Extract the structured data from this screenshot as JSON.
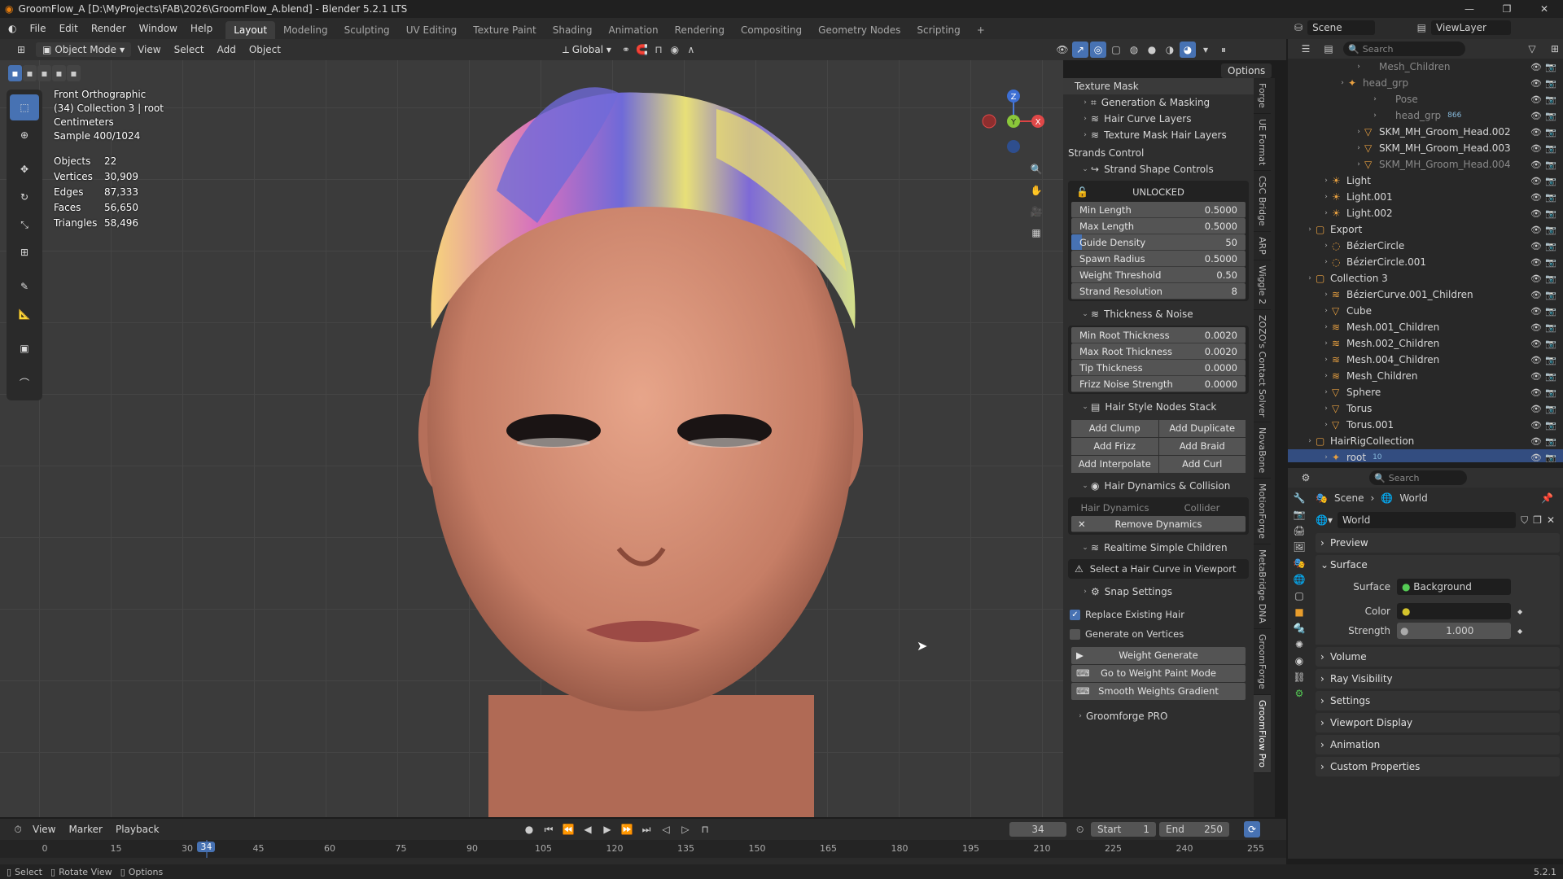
{
  "title": "GroomFlow_A [D:\\MyProjects\\FAB\\2026\\GroomFlow_A.blend] - Blender 5.2.1 LTS",
  "menus": [
    "File",
    "Edit",
    "Render",
    "Window",
    "Help"
  ],
  "workspaces": [
    "Layout",
    "Modeling",
    "Sculpting",
    "UV Editing",
    "Texture Paint",
    "Shading",
    "Animation",
    "Rendering",
    "Compositing",
    "Geometry Nodes",
    "Scripting"
  ],
  "viewport_header": {
    "mode": "Object Mode",
    "menus": [
      "View",
      "Select",
      "Add",
      "Object"
    ],
    "transform": "Global",
    "options": "Options"
  },
  "viewport_info": {
    "view": "Front Orthographic",
    "collection": "(34) Collection 3 | root",
    "units": "Centimeters",
    "sample": "Sample 400/1024"
  },
  "stats": [
    {
      "label": "Objects",
      "value": "22"
    },
    {
      "label": "Vertices",
      "value": "30,909"
    },
    {
      "label": "Edges",
      "value": "87,333"
    },
    {
      "label": "Faces",
      "value": "56,650"
    },
    {
      "label": "Triangles",
      "value": "58,496"
    }
  ],
  "gizmo": {
    "z": "Z",
    "y": "Y",
    "x": "X"
  },
  "npanel": {
    "texture_mask": "Texture Mask",
    "gen_masking": "Generation & Masking",
    "hair_curve_layers": "Hair Curve Layers",
    "texture_mask_layers": "Texture Mask Hair Layers",
    "strands_control": "Strands Control",
    "strand_shape": "Strand Shape Controls",
    "unlocked": "UNLOCKED",
    "shape_fields": [
      {
        "label": "Min Length",
        "value": "0.5000"
      },
      {
        "label": "Max Length",
        "value": "0.5000"
      },
      {
        "label": "Guide Density",
        "value": "50"
      },
      {
        "label": "Spawn Radius",
        "value": "0.5000"
      },
      {
        "label": "Weight Threshold",
        "value": "0.50"
      },
      {
        "label": "Strand Resolution",
        "value": "8"
      }
    ],
    "thickness_noise": "Thickness & Noise",
    "thickness_fields": [
      {
        "label": "Min Root Thickness",
        "value": "0.0020"
      },
      {
        "label": "Max Root Thickness",
        "value": "0.0020"
      },
      {
        "label": "Tip Thickness",
        "value": "0.0000"
      },
      {
        "label": "Frizz Noise Strength",
        "value": "0.0000"
      }
    ],
    "hair_style_stack": "Hair Style Nodes Stack",
    "style_buttons": [
      "Add Clump",
      "Add Duplicate",
      "Add Frizz",
      "Add Braid",
      "Add Interpolate",
      "Add Curl"
    ],
    "dynamics": "Hair Dynamics & Collision",
    "hair_dynamics": "Hair Dynamics",
    "collider": "Collider",
    "remove_dynamics": "Remove Dynamics",
    "realtime_children": "Realtime Simple Children",
    "select_curve": "Select a Hair Curve in Viewport",
    "snap_settings": "Snap Settings",
    "replace_hair": "Replace Existing Hair",
    "gen_vertices": "Generate on Vertices",
    "weight_generate": "Weight Generate",
    "goto_weight": "Go to Weight Paint Mode",
    "smooth_weights": "Smooth Weights Gradient",
    "groomforge": "Groomforge PRO"
  },
  "side_tabs": [
    "Forge",
    "UE Format",
    "CSC Bridge",
    "ARP",
    "Wiggle 2",
    "ZOZO's Contact Solver",
    "NovaBone",
    "MotionForge",
    "MetaBridge DNA",
    "GroomForge",
    "GroomFlow Pro"
  ],
  "outliner": {
    "scene": "Scene",
    "viewlayer": "ViewLayer",
    "search_placeholder": "Search",
    "rows": [
      {
        "label": "Mesh_Children",
        "indent": 4,
        "dim": true,
        "icon": ""
      },
      {
        "label": "head_grp",
        "indent": 3,
        "dim": true,
        "icon": "✦"
      },
      {
        "label": "Pose",
        "indent": 5,
        "dim": true,
        "icon": ""
      },
      {
        "label": "head_grp",
        "indent": 5,
        "dim": true,
        "icon": "",
        "badge": "866"
      },
      {
        "label": "SKM_MH_Groom_Head.002",
        "indent": 4,
        "dim": false,
        "icon": "▽"
      },
      {
        "label": "SKM_MH_Groom_Head.003",
        "indent": 4,
        "dim": false,
        "icon": "▽"
      },
      {
        "label": "SKM_MH_Groom_Head.004",
        "indent": 4,
        "dim": true,
        "icon": "▽"
      },
      {
        "label": "Light",
        "indent": 2,
        "dim": false,
        "icon": "☀"
      },
      {
        "label": "Light.001",
        "indent": 2,
        "dim": false,
        "icon": "☀"
      },
      {
        "label": "Light.002",
        "indent": 2,
        "dim": false,
        "icon": "☀"
      },
      {
        "label": "Export",
        "indent": 1,
        "dim": false,
        "icon": "▢"
      },
      {
        "label": "BézierCircle",
        "indent": 2,
        "dim": false,
        "icon": "◌"
      },
      {
        "label": "BézierCircle.001",
        "indent": 2,
        "dim": false,
        "icon": "◌"
      },
      {
        "label": "Collection 3",
        "indent": 1,
        "dim": false,
        "icon": "▢"
      },
      {
        "label": "BézierCurve.001_Children",
        "indent": 2,
        "dim": false,
        "icon": "≋"
      },
      {
        "label": "Cube",
        "indent": 2,
        "dim": false,
        "icon": "▽"
      },
      {
        "label": "Mesh.001_Children",
        "indent": 2,
        "dim": false,
        "icon": "≋"
      },
      {
        "label": "Mesh.002_Children",
        "indent": 2,
        "dim": false,
        "icon": "≋"
      },
      {
        "label": "Mesh.004_Children",
        "indent": 2,
        "dim": false,
        "icon": "≋"
      },
      {
        "label": "Mesh_Children",
        "indent": 2,
        "dim": false,
        "icon": "≋"
      },
      {
        "label": "Sphere",
        "indent": 2,
        "dim": false,
        "icon": "▽"
      },
      {
        "label": "Torus",
        "indent": 2,
        "dim": false,
        "icon": "▽"
      },
      {
        "label": "Torus.001",
        "indent": 2,
        "dim": false,
        "icon": "▽"
      },
      {
        "label": "HairRigCollection",
        "indent": 1,
        "dim": false,
        "icon": "▢"
      },
      {
        "label": "root",
        "indent": 2,
        "dim": false,
        "icon": "✦",
        "selected": true,
        "badge": "10"
      }
    ]
  },
  "properties": {
    "search_placeholder": "Search",
    "breadcrumb_scene": "Scene",
    "breadcrumb_world": "World",
    "world_name": "World",
    "panels_top": [
      "Preview"
    ],
    "surface": "Surface",
    "surface_label": "Surface",
    "surface_value": "Background",
    "color_label": "Color",
    "strength_label": "Strength",
    "strength_value": "1.000",
    "panels_bottom": [
      "Volume",
      "Ray Visibility",
      "Settings",
      "Viewport Display",
      "Animation",
      "Custom Properties"
    ]
  },
  "timeline": {
    "menus": [
      "View",
      "Marker",
      "Playback"
    ],
    "current_frame": "34",
    "start_label": "Start",
    "start": "1",
    "end_label": "End",
    "end": "250",
    "ticks": [
      "0",
      "15",
      "30",
      "45",
      "60",
      "75",
      "90",
      "105",
      "120",
      "135",
      "150",
      "165",
      "180",
      "195",
      "210",
      "225",
      "240",
      "255"
    ],
    "playhead": "34"
  },
  "status": {
    "select": "Select",
    "rotate": "Rotate View",
    "options": "Options",
    "version": "5.2.1"
  },
  "colors": {
    "accent": "#4772b3",
    "bg": "#3b3b3b"
  }
}
